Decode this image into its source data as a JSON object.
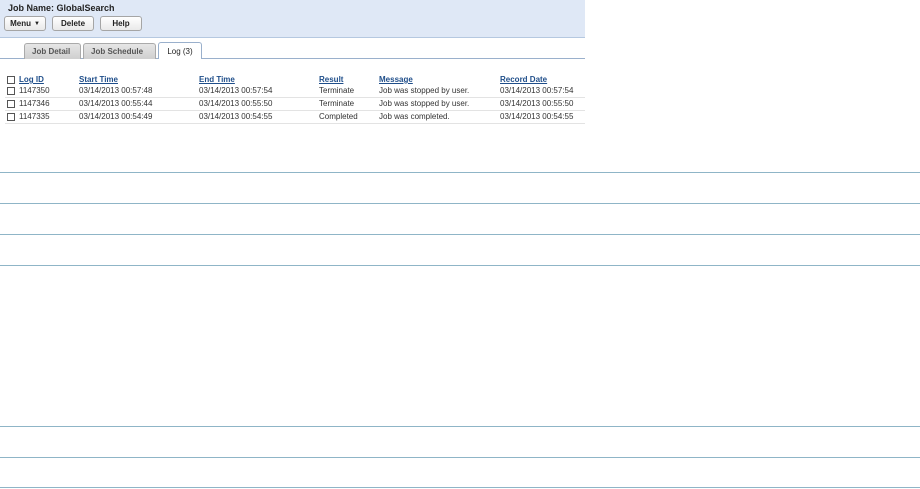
{
  "job": {
    "title": "Job Name: GlobalSearch"
  },
  "toolbar": {
    "menu_label": "Menu",
    "delete_label": "Delete",
    "help_label": "Help"
  },
  "tabs": [
    {
      "label": "Job Detail"
    },
    {
      "label": "Job Schedule"
    },
    {
      "label": "Log (3)"
    }
  ],
  "log_table": {
    "columns": [
      "Log ID",
      "Start Time",
      "End Time",
      "Result",
      "Message",
      "Record Date"
    ],
    "rows": [
      {
        "id": "1147350",
        "start": "03/14/2013 00:57:48",
        "end": "03/14/2013 00:57:54",
        "result": "Terminate",
        "message": "Job was stopped by user.",
        "record": "03/14/2013 00:57:54"
      },
      {
        "id": "1147346",
        "start": "03/14/2013 00:55:44",
        "end": "03/14/2013 00:55:50",
        "result": "Terminate",
        "message": "Job was stopped by user.",
        "record": "03/14/2013 00:55:50"
      },
      {
        "id": "1147335",
        "start": "03/14/2013 00:54:49",
        "end": "03/14/2013 00:54:55",
        "result": "Completed",
        "message": "Job was completed.",
        "record": "03/14/2013 00:54:55"
      }
    ]
  },
  "colors": {
    "header_bg": "#dfe8f6",
    "link": "#1f4e8a",
    "divider": "#8fb5c7"
  }
}
